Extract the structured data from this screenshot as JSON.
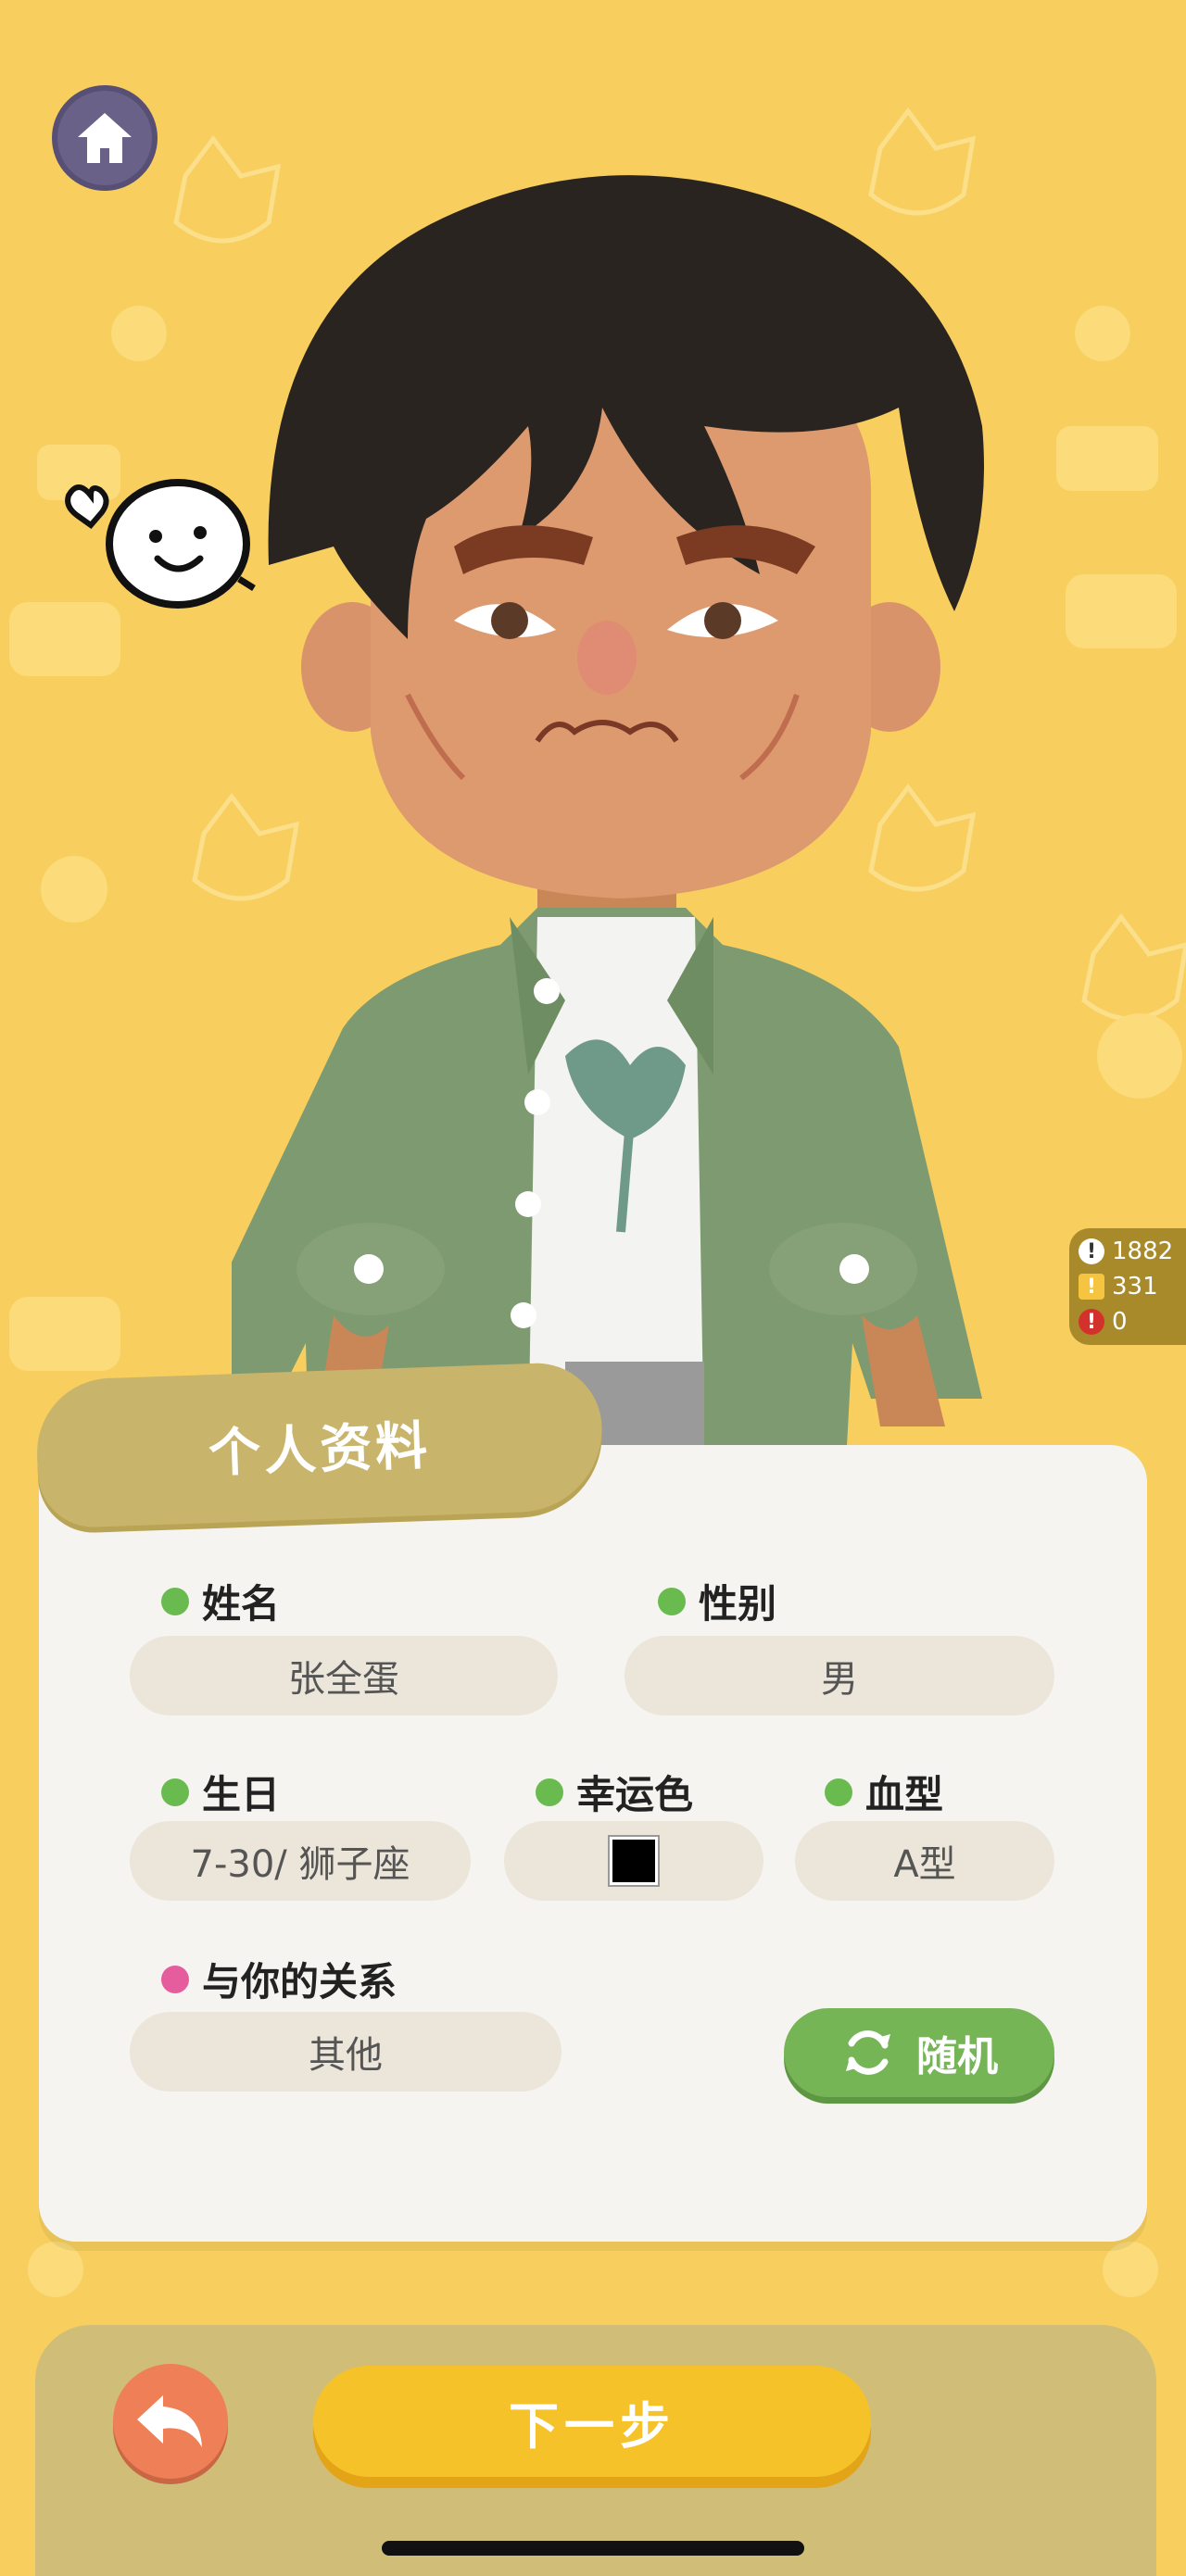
{
  "stats": {
    "info_count": "1882",
    "warning_count": "331",
    "error_count": "0"
  },
  "profile": {
    "title": "个人资料",
    "name_label": "姓名",
    "name_value": "张全蛋",
    "gender_label": "性别",
    "gender_value": "男",
    "birthday_label": "生日",
    "birthday_value": "7-30/ 狮子座",
    "lucky_color_label": "幸运色",
    "lucky_color_value": "#000000",
    "blood_type_label": "血型",
    "blood_type_value": "A型",
    "relation_label": "与你的关系",
    "relation_value": "其他",
    "random_button": "随机"
  },
  "footer": {
    "next_button": "下一步"
  },
  "colors": {
    "background": "#f8cf5e",
    "label_dot_green": "#6abb4f",
    "label_dot_pink": "#e65d9e",
    "random_button": "#75b556",
    "next_button": "#f6c22a",
    "back_button": "#ee7f56"
  },
  "icons": {
    "home": "home-icon",
    "back": "back-arrow-icon",
    "random": "refresh-icon"
  }
}
